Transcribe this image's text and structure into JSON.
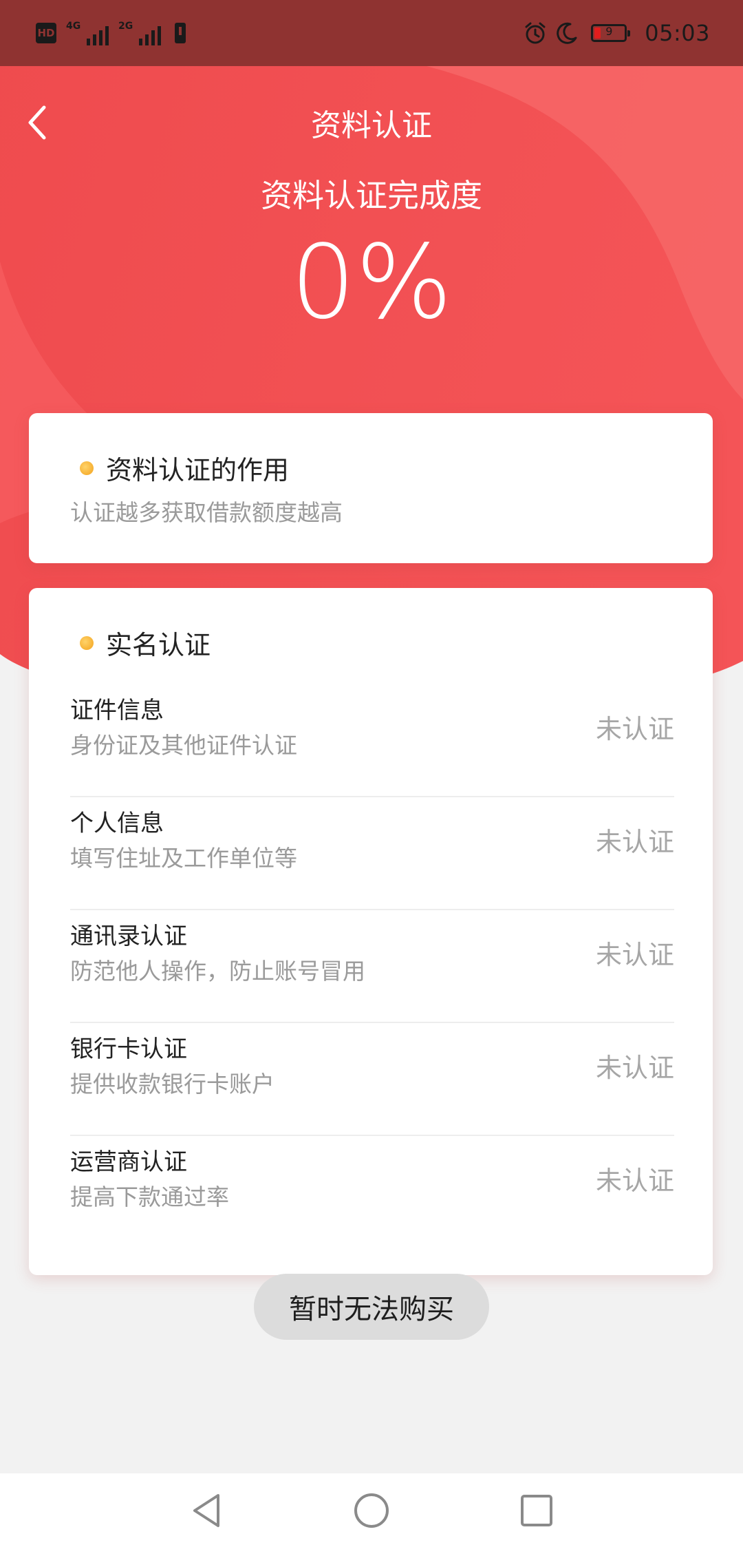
{
  "status_bar": {
    "hd": "HD",
    "net1": "4G",
    "net2": "2G",
    "battery_level": "9",
    "time": "05:03",
    "icons": [
      "hd-icon",
      "signal-icon",
      "alert-icon",
      "alarm-icon",
      "moon-icon",
      "battery-icon"
    ]
  },
  "header": {
    "title": "资料认证",
    "back_icon": "chevron-left-icon"
  },
  "progress": {
    "label": "资料认证完成度",
    "value": "0%"
  },
  "purpose_card": {
    "title": "资料认证的作用",
    "description": "认证越多获取借款额度越高"
  },
  "realname_card": {
    "title": "实名认证",
    "items": [
      {
        "title": "证件信息",
        "subtitle": "身份证及其他证件认证",
        "status": "未认证"
      },
      {
        "title": "个人信息",
        "subtitle": "填写住址及工作单位等",
        "status": "未认证"
      },
      {
        "title": "通讯录认证",
        "subtitle": "防范他人操作，防止账号冒用",
        "status": "未认证"
      },
      {
        "title": "银行卡认证",
        "subtitle": "提供收款银行卡账户",
        "status": "未认证"
      },
      {
        "title": "运营商认证",
        "subtitle": "提高下款通过率",
        "status": "未认证"
      }
    ]
  },
  "toast": {
    "text": "暂时无法购买"
  },
  "colors": {
    "header_red": "#f15456",
    "status_bar": "#8f3331",
    "dot_orange": "#f3a21c",
    "muted_text": "#9a9a9a"
  },
  "nav_bar": {
    "icons": [
      "back-triangle-icon",
      "home-circle-icon",
      "recents-square-icon"
    ]
  }
}
